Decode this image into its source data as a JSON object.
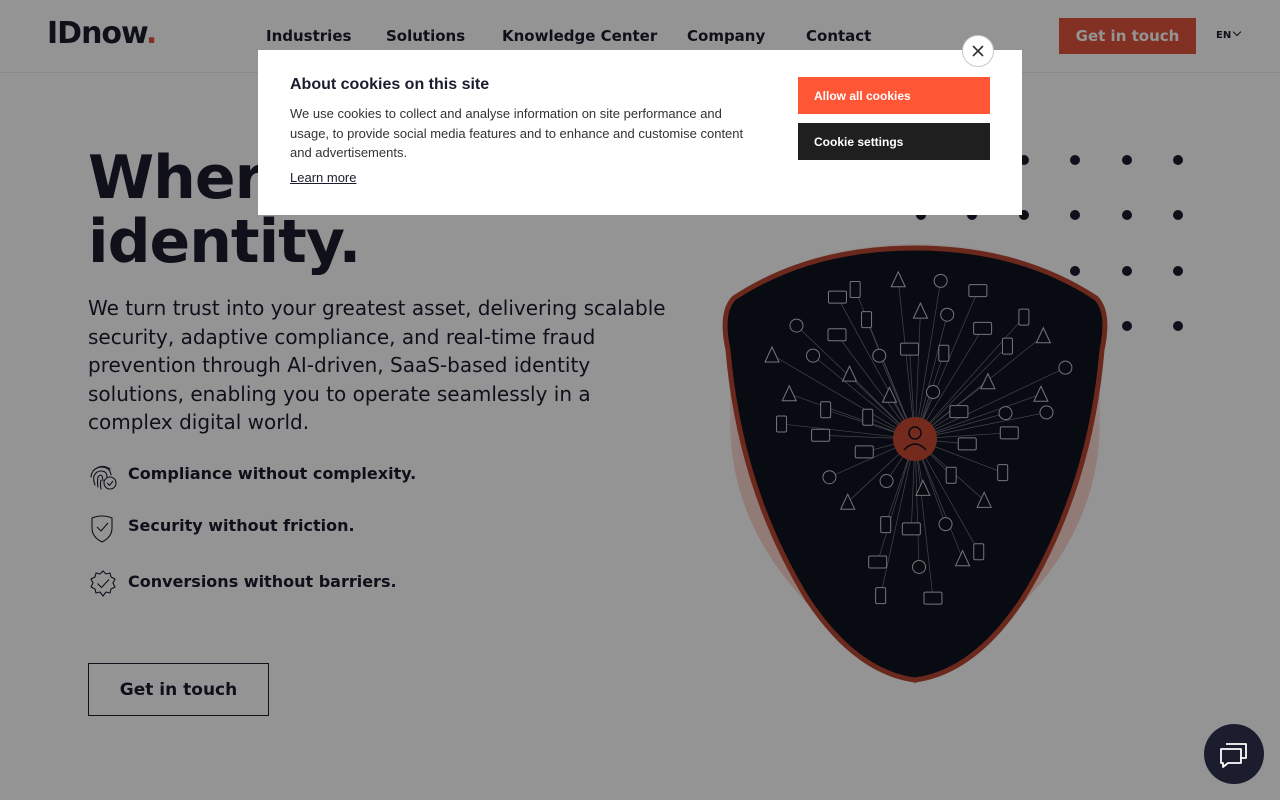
{
  "header": {
    "logo_text": "IDnow",
    "logo_dot": ".",
    "nav": [
      "Industries",
      "Solutions",
      "Knowledge Center",
      "Company",
      "Contact"
    ],
    "cta_label": "Get in touch",
    "language": "EN"
  },
  "hero": {
    "title_line1": "Where",
    "title_line2": "identity.",
    "description": "We turn trust into your greatest asset, delivering scalable security, adaptive compliance, and real-time fraud prevention through AI-driven, SaaS-based identity solutions, enabling you to operate seamlessly in a complex digital world.",
    "benefits": [
      {
        "icon": "fingerprint-check-icon",
        "text": "Compliance without complexity."
      },
      {
        "icon": "shield-check-icon",
        "text": "Security without friction."
      },
      {
        "icon": "badge-check-icon",
        "text": "Conversions without barriers."
      }
    ],
    "cta_label": "Get in touch"
  },
  "illustration": {
    "icon": "identity-network-shield-icon",
    "colors": {
      "shield": "#11131f",
      "accent": "#e1533a"
    }
  },
  "cookie_banner": {
    "title": "About cookies on this site",
    "text": "We use cookies to collect and analyse information on site performance and usage, to provide social media features and to enhance and customise content and advertisements.",
    "learn_more": "Learn more",
    "allow_all_label": "Allow all cookies",
    "settings_label": "Cookie settings",
    "close_icon": "close-icon"
  },
  "chat": {
    "icon": "chat-icon"
  },
  "colors": {
    "brand": "#e1533a",
    "dark": "#1b1d2e",
    "allow_button": "#ff5635",
    "settings_button": "#1f1f1f"
  }
}
